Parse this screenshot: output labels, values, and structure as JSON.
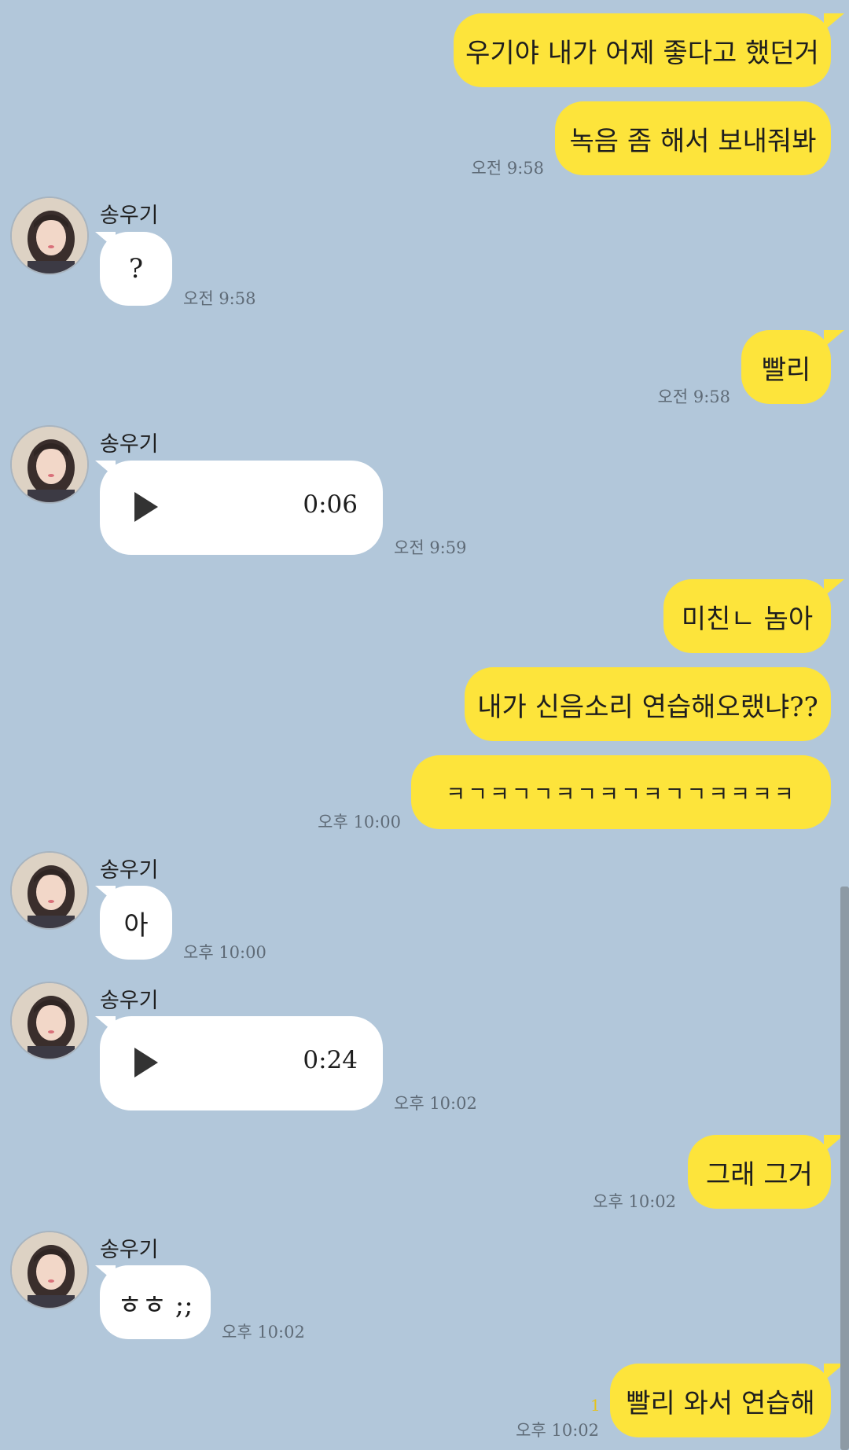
{
  "contact": {
    "name": "송우기"
  },
  "messages": [
    {
      "from": "me",
      "text": "우기야 내가 어제 좋다고 했던거"
    },
    {
      "from": "me",
      "text": "녹음 좀 해서 보내줘봐",
      "time": "오전 9:58"
    },
    {
      "from": "them",
      "text": "?",
      "time": "오전 9:58"
    },
    {
      "from": "me",
      "text": "빨리",
      "time": "오전 9:58"
    },
    {
      "from": "them",
      "type": "voice",
      "duration": "0:06",
      "time": "오전 9:59"
    },
    {
      "from": "me",
      "text": "미친ㄴ 놈아"
    },
    {
      "from": "me",
      "text": "내가 신음소리 연습해오랬냐??"
    },
    {
      "from": "me",
      "text": "ㅋㄱㅋㄱㄱㅋㄱㅋㄱㅋㄱㄱㅋㅋㅋㅋ",
      "time": "오후 10:00"
    },
    {
      "from": "them",
      "text": "아",
      "time": "오후 10:00"
    },
    {
      "from": "them",
      "type": "voice",
      "duration": "0:24",
      "time": "오후 10:02"
    },
    {
      "from": "me",
      "text": "그래 그거",
      "time": "오후 10:02"
    },
    {
      "from": "them",
      "text": "ㅎㅎ ;;",
      "time": "오후 10:02"
    },
    {
      "from": "me",
      "text": "빨리 와서 연습해",
      "time": "오후 10:02",
      "unread": "1"
    }
  ],
  "icons": {
    "play": "play-icon",
    "avatar": "avatar"
  },
  "colors": {
    "background": "#b2c7da",
    "my_bubble": "#fde43b",
    "their_bubble": "#ffffff"
  }
}
